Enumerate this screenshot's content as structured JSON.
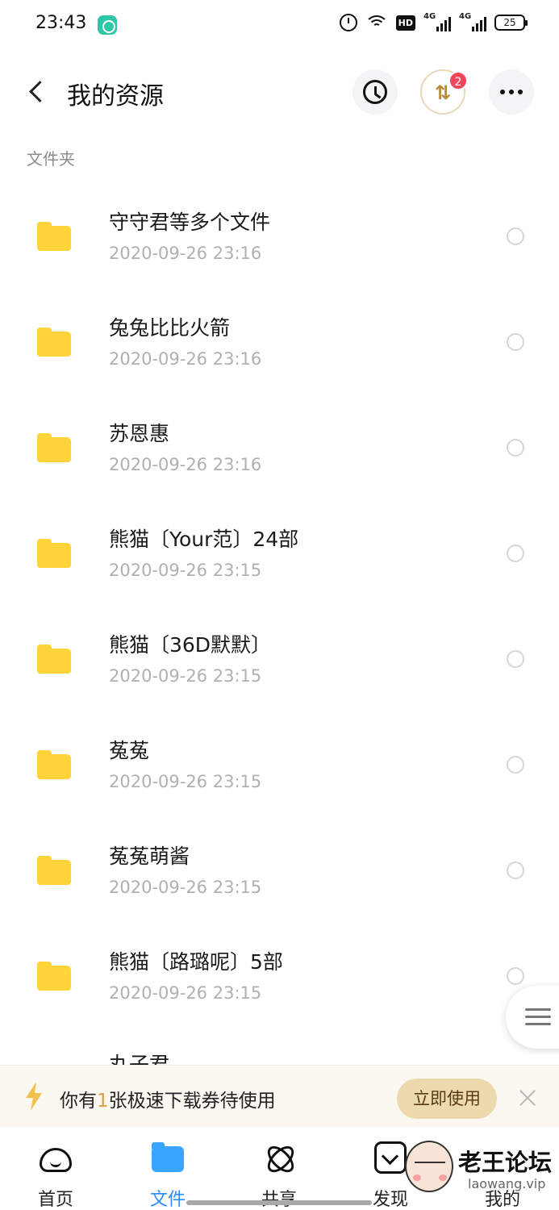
{
  "status_bar": {
    "time": "23:43",
    "network_a": "4G",
    "network_b": "4G",
    "hd_label": "HD",
    "battery": "25"
  },
  "header": {
    "title": "我的资源",
    "transfer_badge": "2"
  },
  "section_label": "文件夹",
  "folders": [
    {
      "name": "守守君等多个文件",
      "date": "2020-09-26  23:16"
    },
    {
      "name": "兔兔比比火箭",
      "date": "2020-09-26  23:16"
    },
    {
      "name": "苏恩惠",
      "date": "2020-09-26  23:16"
    },
    {
      "name": "熊猫〔Your范〕24部",
      "date": "2020-09-26  23:15"
    },
    {
      "name": "熊猫〔36D默默〕",
      "date": "2020-09-26  23:15"
    },
    {
      "name": "菟菟",
      "date": "2020-09-26  23:15"
    },
    {
      "name": "菟菟萌酱",
      "date": "2020-09-26  23:15"
    },
    {
      "name": "熊猫〔路璐呢〕5部",
      "date": "2020-09-26  23:15"
    }
  ],
  "partial_folder": {
    "name": "丸子君"
  },
  "promo": {
    "text_before": "你有",
    "count": "1",
    "text_after": "张极速下载券待使用",
    "button": "立即使用"
  },
  "bottom_nav": [
    {
      "label": "首页",
      "icon": "cloud-home-icon"
    },
    {
      "label": "文件",
      "icon": "folder-icon",
      "active": true
    },
    {
      "label": "共享",
      "icon": "share-orbit-icon"
    },
    {
      "label": "发现",
      "icon": "discover-icon"
    },
    {
      "label": "我的",
      "icon": "profile-icon"
    }
  ],
  "watermark": {
    "title": "老王论坛",
    "url": "laowang.vip"
  },
  "colors": {
    "folder": "#ffd43b",
    "active_nav": "#2a8cff",
    "badge": "#f0465b",
    "promo_button": "#ecd9ad"
  }
}
